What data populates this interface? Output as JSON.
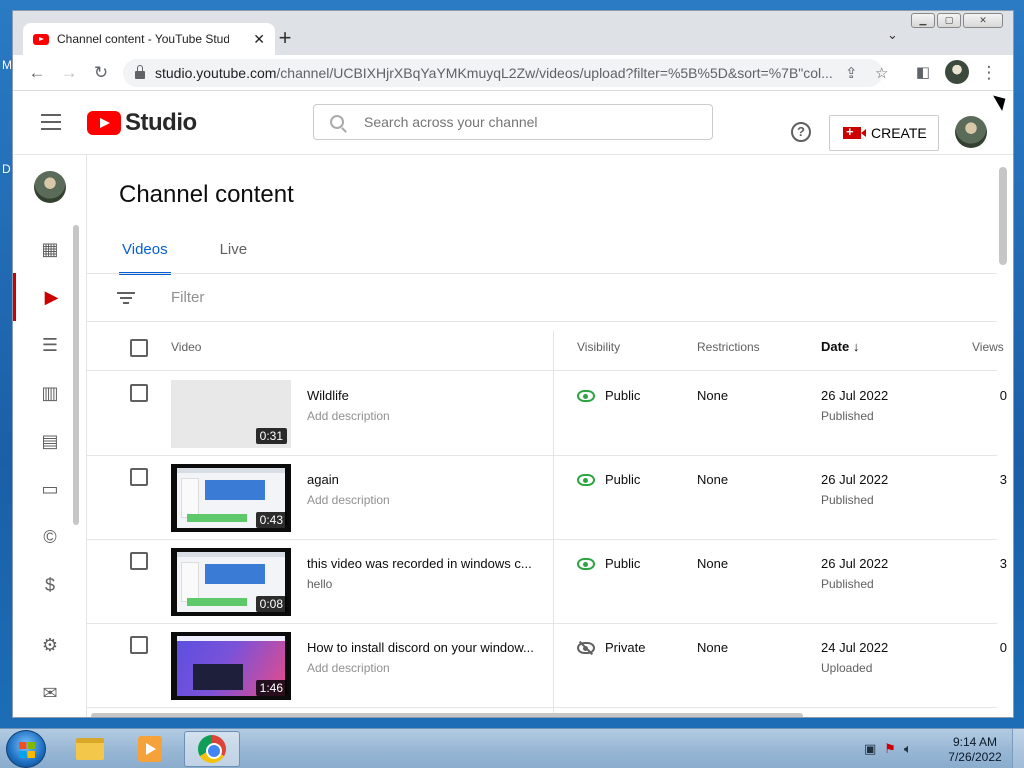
{
  "browser": {
    "tab_title": "Channel content - YouTube Studio",
    "url_host": "studio.youtube.com",
    "url_path": "/channel/UCBIXHjrXBqYaYMKmuyqL2Zw/videos/upload?filter=%5B%5D&sort=%7B\"col...",
    "icons": [
      "back-icon",
      "forward-icon",
      "reload-icon",
      "lock-icon",
      "share-icon",
      "star-icon",
      "side-panel-icon",
      "profile-avatar",
      "more-icon"
    ]
  },
  "studio": {
    "logo_text": "Studio",
    "search_placeholder": "Search across your channel",
    "create_label": "CREATE",
    "help_glyph": "?"
  },
  "page": {
    "title": "Channel content",
    "tabs": [
      {
        "label": "Videos",
        "active": true
      },
      {
        "label": "Live",
        "active": false
      }
    ],
    "filter_placeholder": "Filter"
  },
  "table": {
    "headers": {
      "video": "Video",
      "visibility": "Visibility",
      "restrictions": "Restrictions",
      "date": "Date",
      "date_sort": "↓",
      "views": "Views"
    },
    "rows": [
      {
        "title": "Wildlife",
        "description": "Add description",
        "duration": "0:31",
        "visibility": "Public",
        "restrictions": "None",
        "date": "26 Jul 2022",
        "status": "Published",
        "views": "0"
      },
      {
        "title": "again",
        "description": "Add description",
        "duration": "0:43",
        "visibility": "Public",
        "restrictions": "None",
        "date": "26 Jul 2022",
        "status": "Published",
        "views": "3"
      },
      {
        "title": "this video was recorded in windows c...",
        "description": "hello",
        "duration": "0:08",
        "visibility": "Public",
        "restrictions": "None",
        "date": "26 Jul 2022",
        "status": "Published",
        "views": "3"
      },
      {
        "title": "How to install discord on your window...",
        "description": "Add description",
        "duration": "1:46",
        "visibility": "Private",
        "restrictions": "None",
        "date": "24 Jul 2022",
        "status": "Uploaded",
        "views": "0"
      }
    ]
  },
  "taskbar": {
    "time": "9:14 AM",
    "date": "7/26/2022"
  },
  "desktop": {
    "edge_letters": [
      "M",
      "D"
    ]
  },
  "colors": {
    "accent_red": "#cc0000",
    "link_blue": "#065fd4",
    "public_green": "#2ba640"
  }
}
